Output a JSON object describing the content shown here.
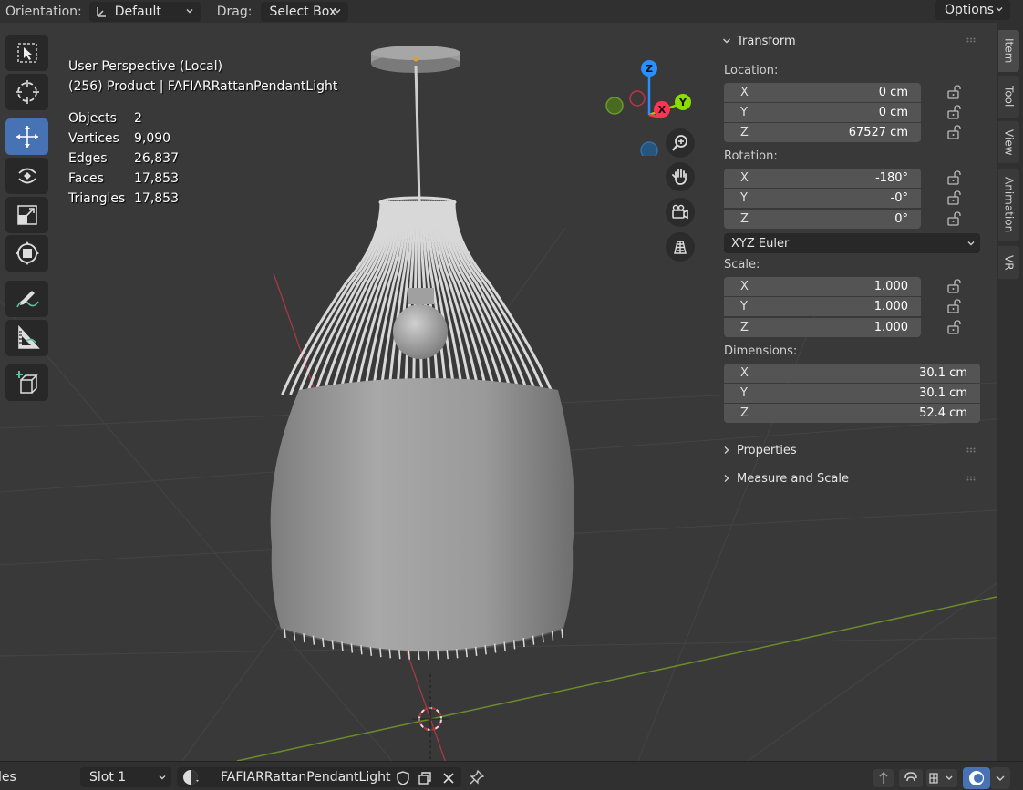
{
  "header": {
    "orientation_label": "Orientation:",
    "orientation_value": "Default",
    "drag_label": "Drag:",
    "drag_value": "Select Box",
    "options_label": "Options"
  },
  "viewport": {
    "perspective": "User Perspective (Local)",
    "collection": "(256) Product | FAFIARRattanPendantLight",
    "stats": [
      {
        "label": "Objects",
        "value": "2"
      },
      {
        "label": "Vertices",
        "value": "9,090"
      },
      {
        "label": "Edges",
        "value": "26,837"
      },
      {
        "label": "Faces",
        "value": "17,853"
      },
      {
        "label": "Triangles",
        "value": "17,853"
      }
    ],
    "gizmo": {
      "x": "X",
      "y": "Y",
      "z": "Z"
    }
  },
  "panel": {
    "transform_title": "Transform",
    "location_label": "Location:",
    "location": [
      {
        "axis": "X",
        "value": "0 cm"
      },
      {
        "axis": "Y",
        "value": "0 cm"
      },
      {
        "axis": "Z",
        "value": "67527 cm"
      }
    ],
    "rotation_label": "Rotation:",
    "rotation": [
      {
        "axis": "X",
        "value": "-180°"
      },
      {
        "axis": "Y",
        "value": "-0°"
      },
      {
        "axis": "Z",
        "value": "0°"
      }
    ],
    "rotation_mode": "XYZ Euler",
    "scale_label": "Scale:",
    "scale": [
      {
        "axis": "X",
        "value": "1.000"
      },
      {
        "axis": "Y",
        "value": "1.000"
      },
      {
        "axis": "Z",
        "value": "1.000"
      }
    ],
    "dimensions_label": "Dimensions:",
    "dimensions": [
      {
        "axis": "X",
        "value": "30.1 cm"
      },
      {
        "axis": "Y",
        "value": "30.1 cm"
      },
      {
        "axis": "Z",
        "value": "52.4 cm"
      }
    ],
    "properties_title": "Properties",
    "measure_title": "Measure and Scale"
  },
  "tabs": [
    "Item",
    "Tool",
    "View",
    "Animation",
    "VR"
  ],
  "bottombar": {
    "left_text": "les",
    "slot_value": "Slot 1",
    "material_name": "FAFIARRattanPendantLight"
  },
  "colors": {
    "accent": "#4772b3",
    "axis_x": "#ff3352",
    "axis_y": "#8bdc00",
    "axis_z": "#2890ff"
  }
}
